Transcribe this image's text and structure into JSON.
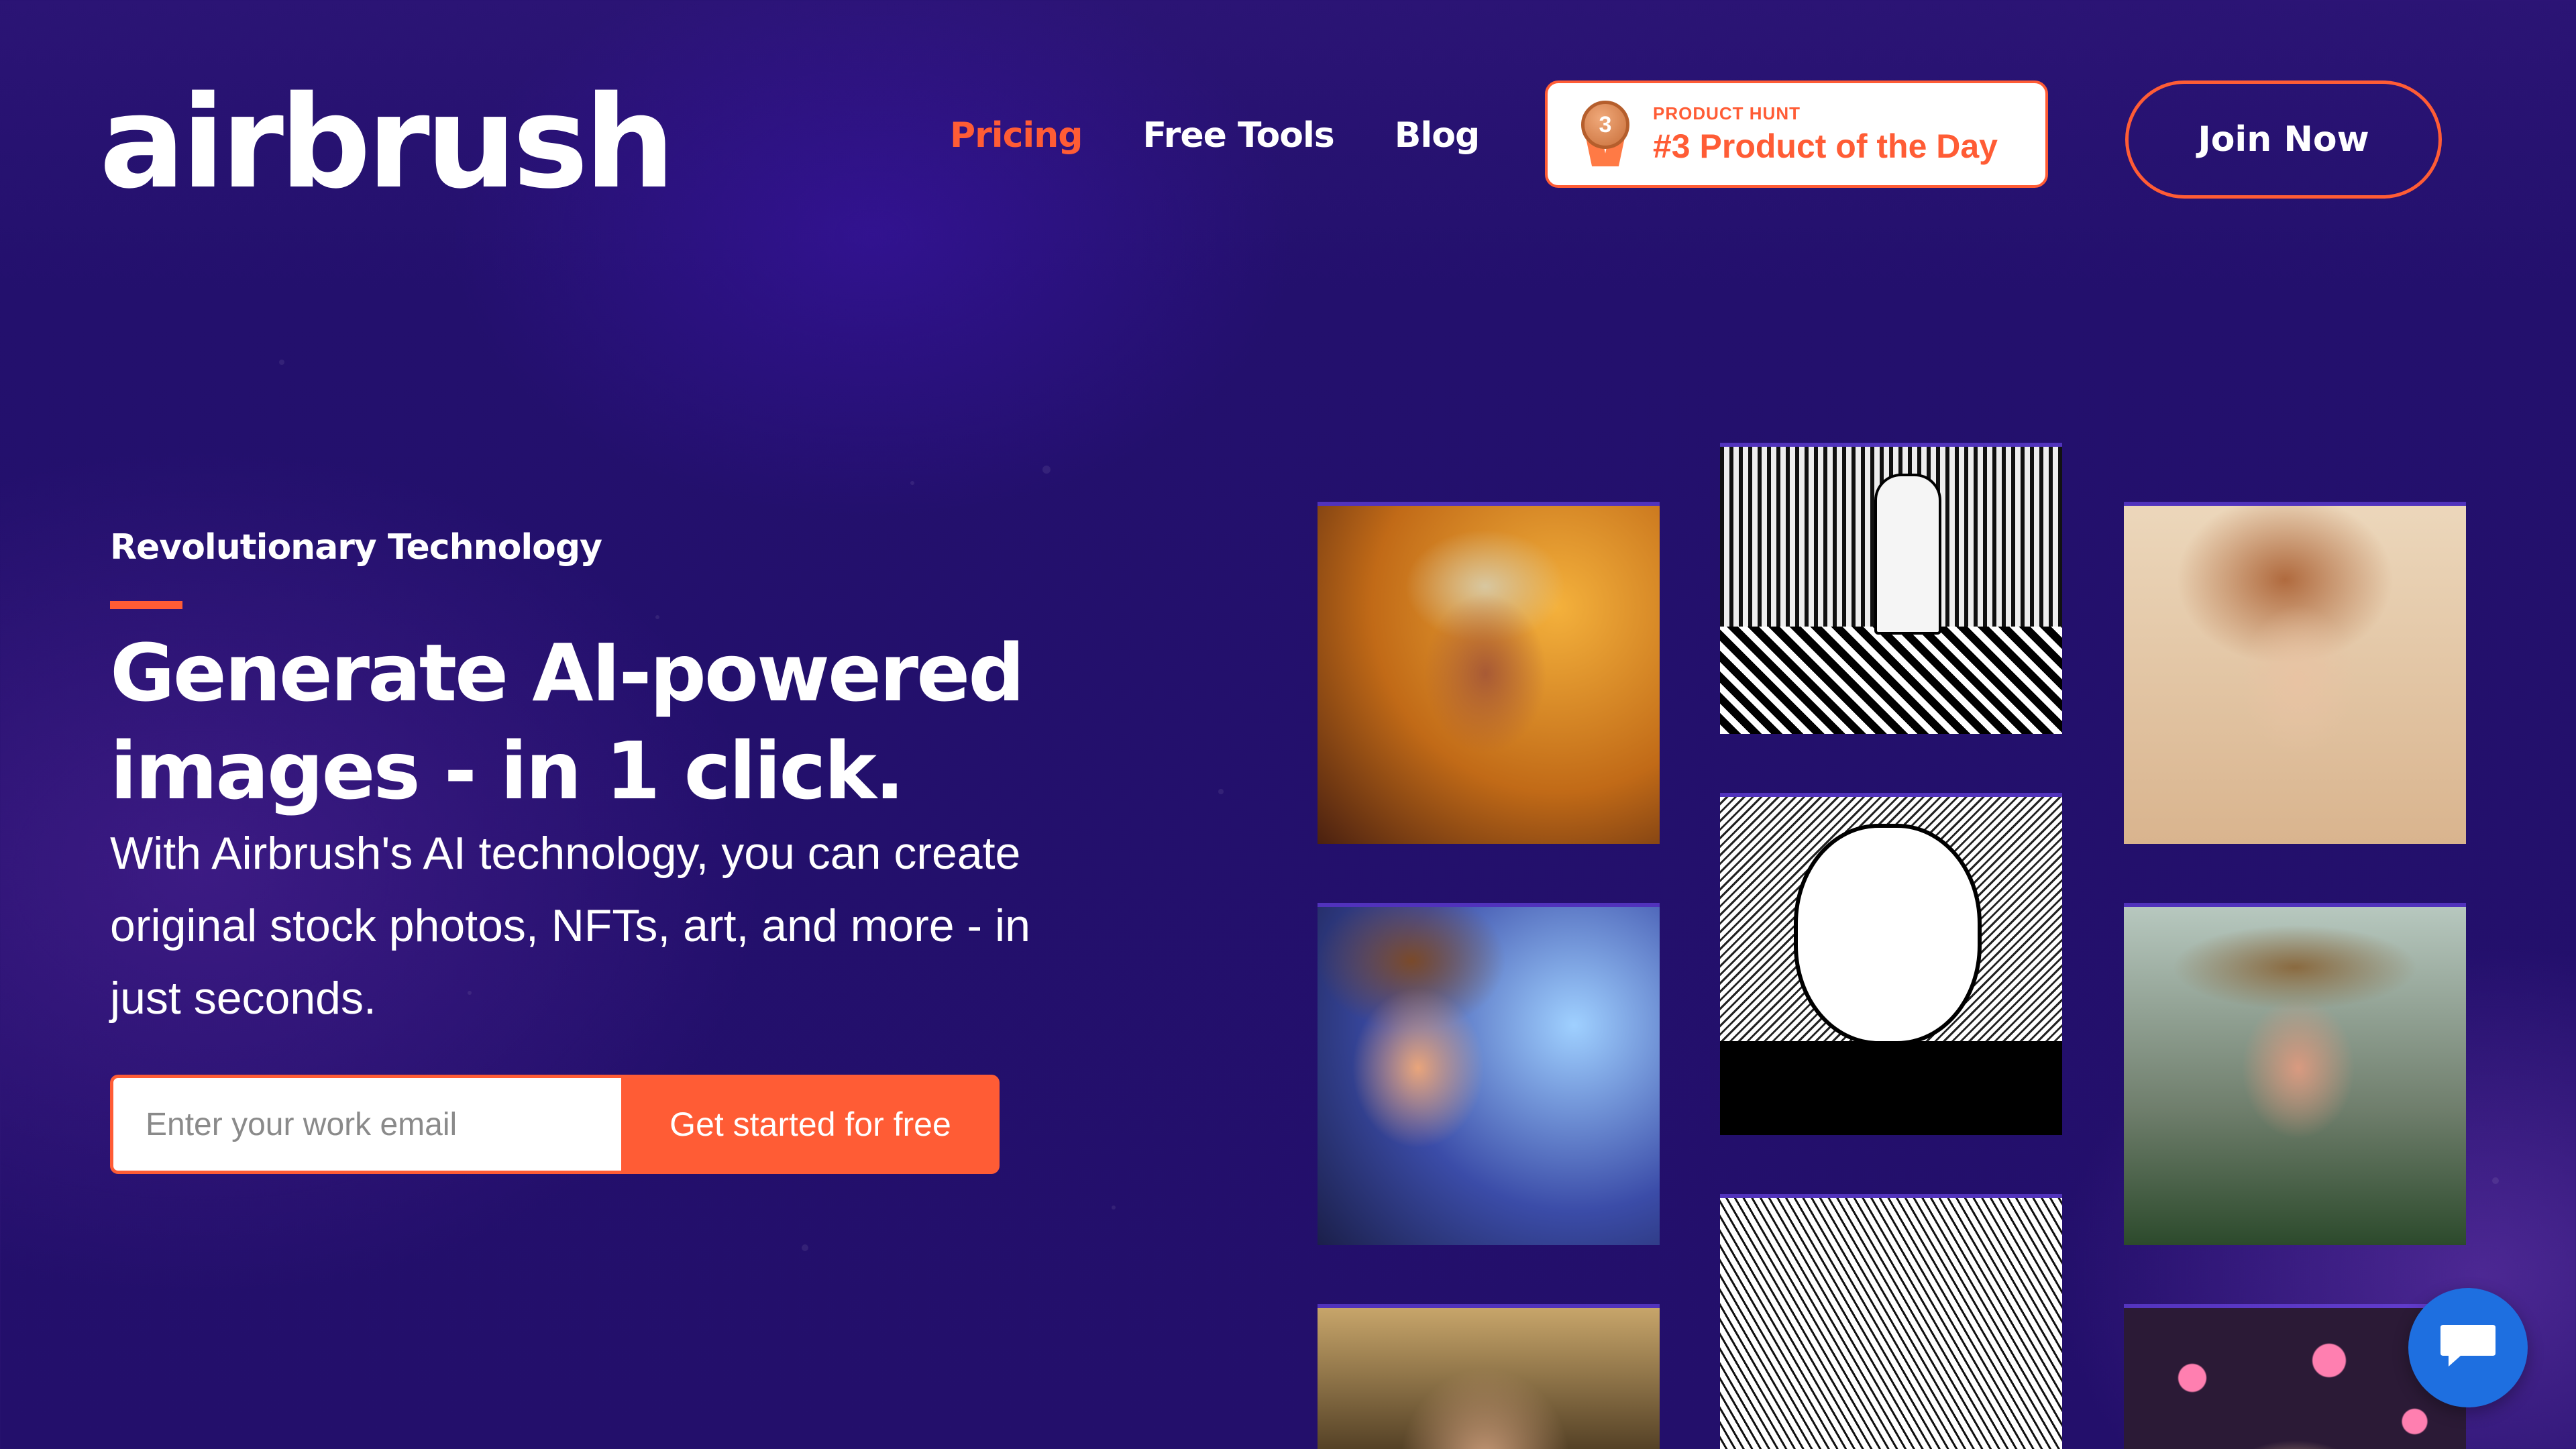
{
  "header": {
    "logo": "airbrush",
    "nav": [
      {
        "label": "Pricing",
        "active": true
      },
      {
        "label": "Free Tools",
        "active": false
      },
      {
        "label": "Blog",
        "active": false
      }
    ],
    "badge": {
      "small": "PRODUCT HUNT",
      "big": "#3 Product of the Day",
      "medal_number": "3",
      "icon": "medal-icon"
    },
    "join_label": "Join Now"
  },
  "hero": {
    "eyebrow": "Revolutionary Technology",
    "headline": "Generate AI-powered images - in 1 click.",
    "subcopy": "With Airbrush's AI technology, you can create original stock photos, NFTs, art, and more - in just seconds.",
    "email_placeholder": "Enter your work email",
    "cta_label": "Get started for free"
  },
  "colors": {
    "accent": "#ff5c35",
    "background": "#23106d",
    "chat": "#1e6fe0"
  },
  "chat": {
    "icon": "chat-bubble-icon"
  }
}
